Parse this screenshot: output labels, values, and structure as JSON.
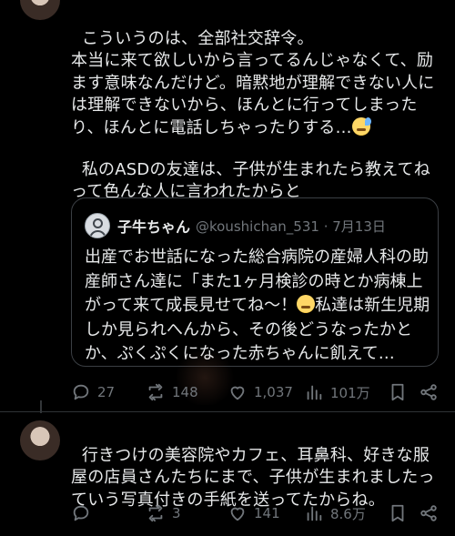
{
  "tweet1": {
    "text": "こういうのは、全部社交辞令。\n本当に来て欲しいから言ってるんじゃなくて、励ます意味なんだけど。暗黙地が理解できない人には理解できないから、ほんとに行ってしまったり、ほんとに電話しちゃったりする…",
    "text2": "私のASDの友達は、子供が生まれたら教えてねって色んな人に言われたからと",
    "emoji": "sweat-face-emoji",
    "quote": {
      "name": "子牛ちゃん",
      "handle": "@koushichan_531 · 7月13日",
      "text": "出産でお世話になった総合病院の産婦人科の助産師さん達に「また1ヶ月検診の時とか病棟上がって来て成長見せてね〜！",
      "text_after_emoji": "私達は新生児期しか見られへんから、その後どうなったかとか、ぷくぷくになった赤ちゃんに飢えて…",
      "emoji": "pleading-face-emoji"
    },
    "actions": {
      "replies": "27",
      "retweets": "148",
      "likes": "1,037",
      "views": "101万"
    }
  },
  "tweet2": {
    "text": "行きつけの美容院やカフェ、耳鼻科、好きな服屋の店員さんたちにまで、子供が生まれましたっていう写真付きの手紙を送ってたからね。",
    "actions": {
      "replies": "",
      "retweets": "3",
      "likes": "141",
      "views": "8.6万"
    }
  },
  "colors": {
    "background": "#000000",
    "text": "#e7e9ea",
    "muted": "#71767b",
    "border": "#2f3336"
  }
}
